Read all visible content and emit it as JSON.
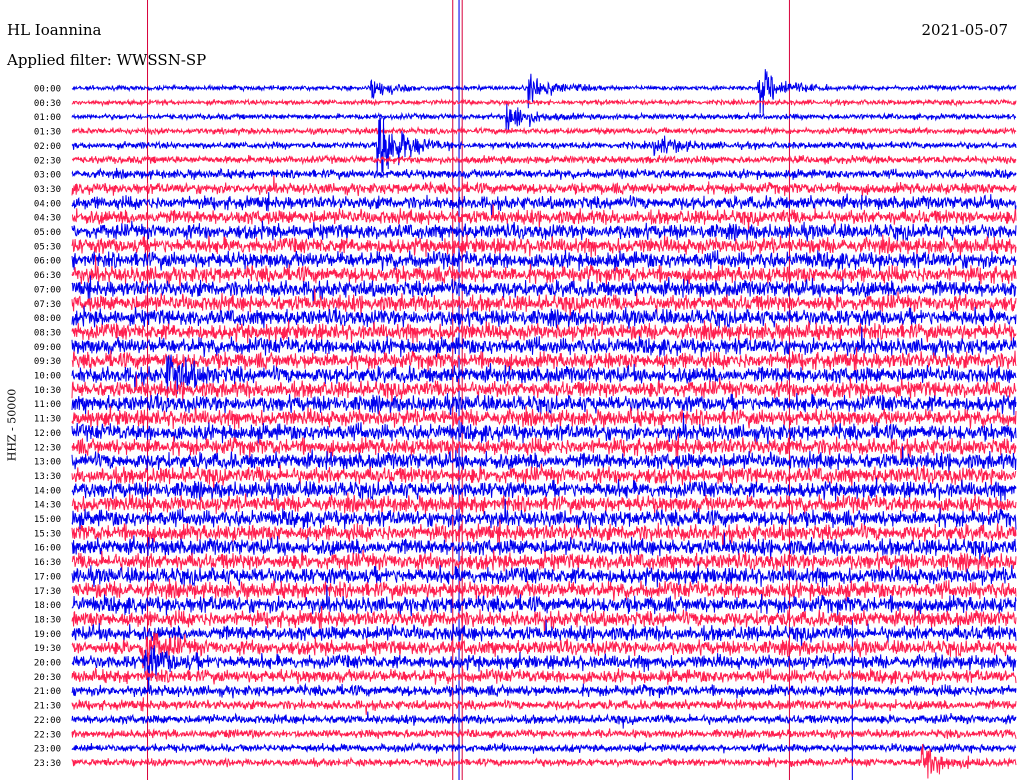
{
  "header": {
    "station": "HL Ioannina",
    "date": "2021-05-07",
    "filter_label": "Applied filter: WWSSN-SP"
  },
  "colors": {
    "trace_a": "#0000ee",
    "trace_b": "#ff1f4f",
    "marker": "#d8003a",
    "marker_blue": "#1a1aee"
  },
  "chart_data": {
    "type": "line",
    "title": "HL Ioannina",
    "channel_label": "HHZ - 50000",
    "row_labels": [
      "00:00",
      "00:30",
      "01:00",
      "01:30",
      "02:00",
      "02:30",
      "03:00",
      "03:30",
      "04:00",
      "04:30",
      "05:00",
      "05:30",
      "06:00",
      "06:30",
      "07:00",
      "07:30",
      "08:00",
      "08:30",
      "09:00",
      "09:30",
      "10:00",
      "10:30",
      "11:00",
      "11:30",
      "12:00",
      "12:30",
      "13:00",
      "13:30",
      "14:00",
      "14:30",
      "15:00",
      "15:30",
      "16:00",
      "16:30",
      "17:00",
      "17:30",
      "18:00",
      "18:30",
      "19:00",
      "19:30",
      "20:00",
      "20:30",
      "21:00",
      "21:30",
      "22:00",
      "22:30",
      "23:00",
      "23:30"
    ],
    "trace_minutes": 30,
    "row_activity": [
      0.15,
      0.18,
      0.2,
      0.25,
      0.3,
      0.35,
      0.45,
      0.6,
      0.75,
      0.85,
      0.9,
      0.95,
      1.0,
      1.0,
      1.0,
      1.0,
      1.0,
      1.0,
      1.0,
      1.0,
      1.0,
      1.0,
      1.0,
      1.0,
      1.0,
      1.0,
      1.0,
      1.0,
      1.0,
      1.0,
      1.0,
      1.0,
      1.0,
      1.0,
      1.0,
      1.0,
      1.0,
      0.95,
      0.9,
      0.85,
      0.8,
      0.75,
      0.6,
      0.5,
      0.45,
      0.4,
      0.38,
      0.35
    ],
    "events": [
      {
        "row": 0,
        "minute": 9.5,
        "amp": 0.7
      },
      {
        "row": 0,
        "minute": 14.5,
        "amp": 1.1
      },
      {
        "row": 0,
        "minute": 21.8,
        "amp": 1.8
      },
      {
        "row": 2,
        "minute": 13.8,
        "amp": 1.2
      },
      {
        "row": 4,
        "minute": 9.7,
        "amp": 3.2
      },
      {
        "row": 4,
        "minute": 18.5,
        "amp": 0.8
      },
      {
        "row": 20,
        "minute": 3.0,
        "amp": 1.6
      },
      {
        "row": 39,
        "minute": 2.2,
        "amp": 1.4
      },
      {
        "row": 40,
        "minute": 2.3,
        "amp": 1.2
      },
      {
        "row": 47,
        "minute": 27.0,
        "amp": 1.3
      }
    ],
    "marker_minutes": [
      2.4,
      12.1,
      12.4,
      22.8
    ],
    "blue_marker_minutes": [
      12.3,
      24.8
    ],
    "grid": false
  }
}
